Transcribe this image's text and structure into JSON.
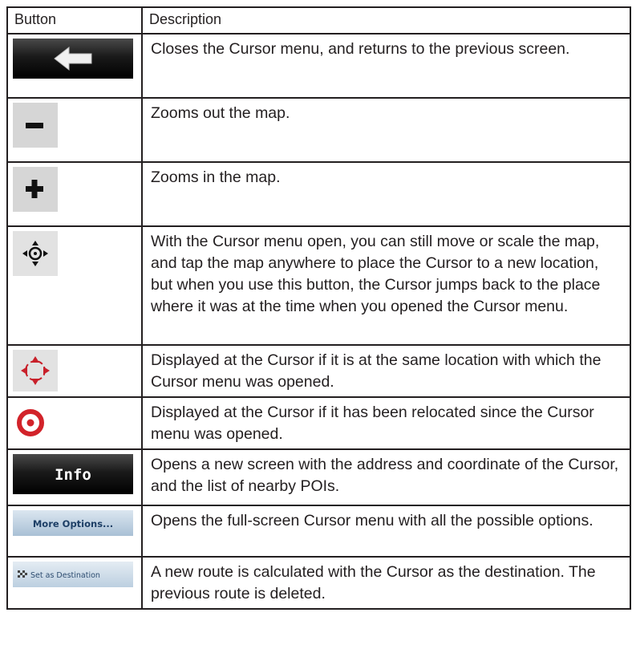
{
  "table": {
    "headers": {
      "button": "Button",
      "description": "Description"
    },
    "rows": [
      {
        "icon": "back-arrow-icon",
        "description": "Closes the Cursor menu, and returns to the previous screen."
      },
      {
        "icon": "zoom-out-icon",
        "description": "Zooms out the map."
      },
      {
        "icon": "zoom-in-icon",
        "description": "Zooms in the map."
      },
      {
        "icon": "recenter-cursor-icon",
        "description": "With the Cursor menu open, you can still move or scale the map, and tap the map anywhere to place the Cursor to a new location, but when you use this button, the Cursor jumps back to the place where it was at the time when you opened the Cursor menu."
      },
      {
        "icon": "cursor-original-location-icon",
        "description": "Displayed at the Cursor if it is at the same location with which the Cursor menu was opened."
      },
      {
        "icon": "cursor-relocated-icon",
        "description": "Displayed at the Cursor if it has been relocated since the Cursor menu was opened."
      },
      {
        "icon": "info-button-icon",
        "label": "Info",
        "description": "Opens a new screen with the address and coordinate of the Cursor, and the list of nearby POIs."
      },
      {
        "icon": "more-options-button-icon",
        "label": "More Options...",
        "description": "Opens the full-screen Cursor menu with all the possible options."
      },
      {
        "icon": "set-as-destination-button-icon",
        "label": "Set as Destination",
        "description": "A new route is calculated with the Cursor as the destination. The previous route is deleted."
      }
    ]
  }
}
